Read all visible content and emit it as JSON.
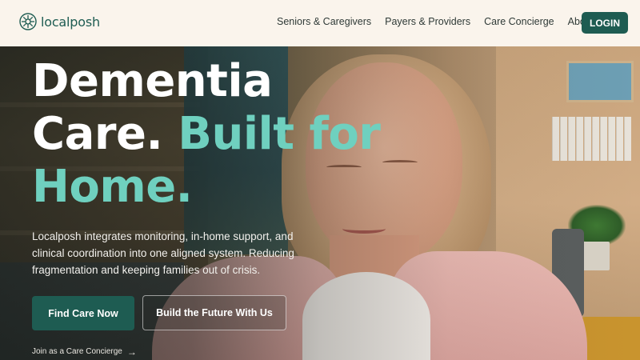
{
  "brand": {
    "name": "localposh",
    "color": "#1e5c52"
  },
  "nav": {
    "items": [
      {
        "label": "Seniors & Caregivers"
      },
      {
        "label": "Payers & Providers"
      },
      {
        "label": "Care Concierge"
      },
      {
        "label": "About"
      }
    ],
    "login_label": "LOGIN"
  },
  "hero": {
    "headline_line1": "Dementia",
    "headline_line2a": "Care.",
    "headline_line2b": "Built for",
    "headline_line3": "Home.",
    "description": "Localposh integrates monitoring, in-home support, and clinical coordination into one aligned system. Reducing fragmentation and keeping families out of crisis.",
    "primary_cta": "Find Care Now",
    "secondary_cta": "Build the Future With Us",
    "join_link": "Join as a Care Concierge",
    "join_arrow": "→",
    "accent_color": "#6fd0bf"
  }
}
